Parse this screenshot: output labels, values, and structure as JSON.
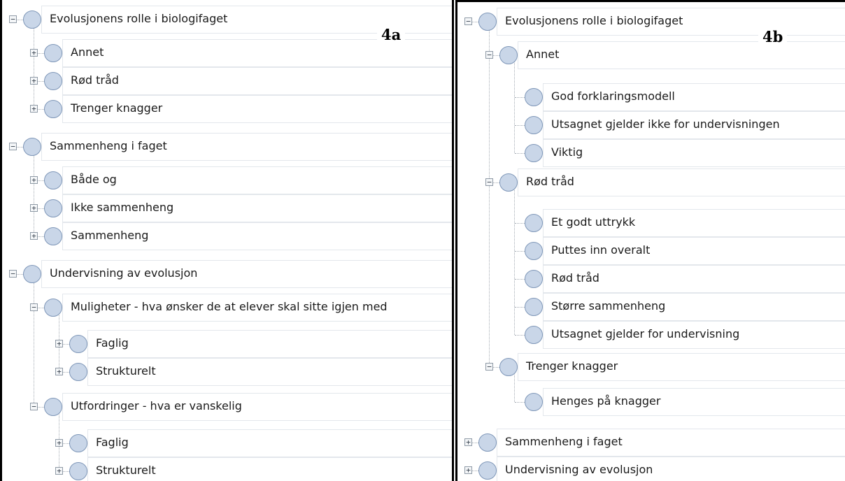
{
  "panel_a": {
    "label": "4a",
    "rows": [
      {
        "text": "Evolusjonens rolle i biologifaget",
        "level": 0,
        "expander": "−"
      },
      {
        "text": "Annet",
        "level": 1,
        "expander": "+"
      },
      {
        "text": "Rød tråd",
        "level": 1,
        "expander": "+"
      },
      {
        "text": "Trenger knagger",
        "level": 1,
        "expander": "+"
      },
      {
        "text": "Sammenheng i faget",
        "level": 0,
        "expander": "−"
      },
      {
        "text": "Både og",
        "level": 1,
        "expander": "+"
      },
      {
        "text": "Ikke sammenheng",
        "level": 1,
        "expander": "+"
      },
      {
        "text": "Sammenheng",
        "level": 1,
        "expander": "+"
      },
      {
        "text": "Undervisning av evolusjon",
        "level": 0,
        "expander": "−"
      },
      {
        "text": "Muligheter - hva ønsker de at elever skal sitte igjen med",
        "level": 1,
        "expander": "−"
      },
      {
        "text": "Faglig",
        "level": 2,
        "expander": "+"
      },
      {
        "text": "Strukturelt",
        "level": 2,
        "expander": "+"
      },
      {
        "text": "Utfordringer - hva er vanskelig",
        "level": 1,
        "expander": "−"
      },
      {
        "text": "Faglig",
        "level": 2,
        "expander": "+"
      },
      {
        "text": "Strukturelt",
        "level": 2,
        "expander": "+"
      }
    ]
  },
  "panel_b": {
    "label": "4b",
    "rows": [
      {
        "text": "Evolusjonens rolle i biologifaget",
        "level": 0,
        "expander": "−"
      },
      {
        "text": "Annet",
        "level": 1,
        "expander": "−"
      },
      {
        "text": "God forklaringsmodell",
        "level": 2,
        "expander": ""
      },
      {
        "text": "Utsagnet gjelder ikke for undervisningen",
        "level": 2,
        "expander": ""
      },
      {
        "text": "Viktig",
        "level": 2,
        "expander": ""
      },
      {
        "text": "Rød tråd",
        "level": 1,
        "expander": "−"
      },
      {
        "text": "Et godt uttrykk",
        "level": 2,
        "expander": ""
      },
      {
        "text": "Puttes inn overalt",
        "level": 2,
        "expander": ""
      },
      {
        "text": "Rød tråd",
        "level": 2,
        "expander": ""
      },
      {
        "text": "Større sammenheng",
        "level": 2,
        "expander": ""
      },
      {
        "text": "Utsagnet gjelder for undervisning",
        "level": 2,
        "expander": ""
      },
      {
        "text": "Trenger knagger",
        "level": 1,
        "expander": "−"
      },
      {
        "text": "Henges på knagger",
        "level": 2,
        "expander": ""
      },
      {
        "text": "Sammenheng i faget",
        "level": 0,
        "expander": "+"
      },
      {
        "text": "Undervisning av evolusjon",
        "level": 0,
        "expander": "+"
      }
    ]
  },
  "colors": {
    "node_fill": "#c9d6e8",
    "node_border": "#7f97b8",
    "row_border": "#e3e7ec",
    "tree_line": "#a5acb4",
    "panel_border": "#000000"
  }
}
